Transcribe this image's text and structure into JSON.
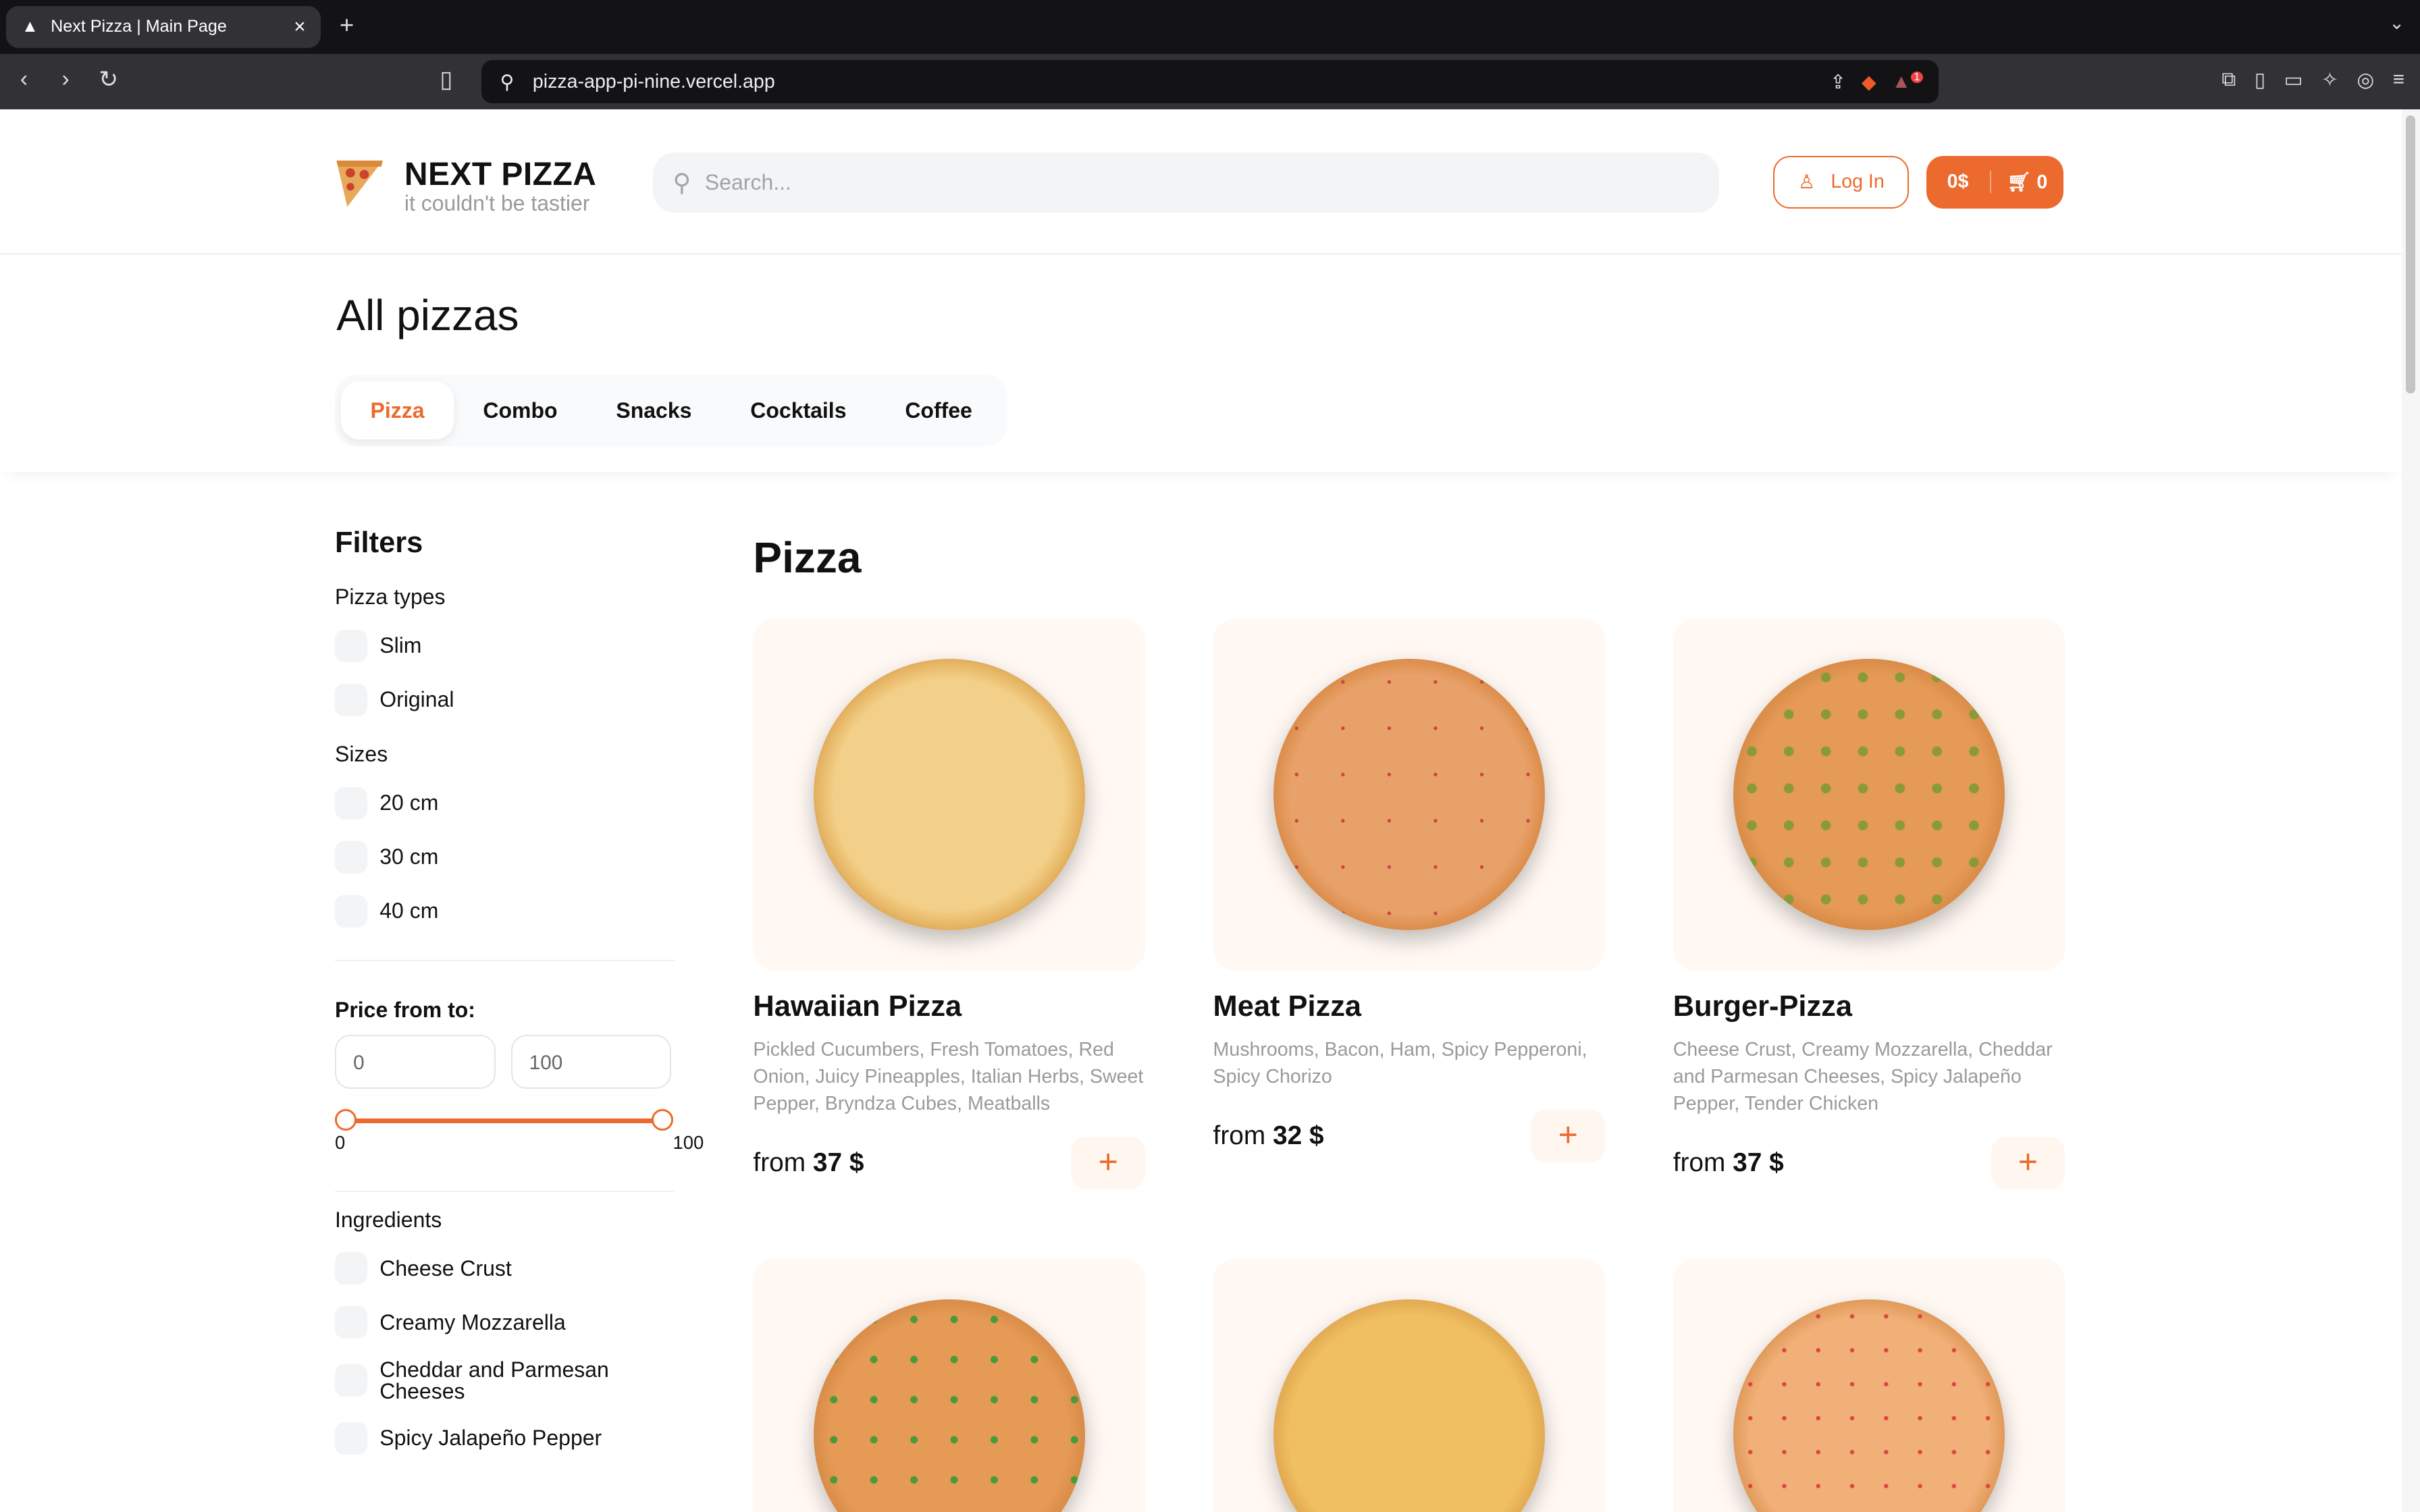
{
  "browser": {
    "tab_title": "Next Pizza | Main Page",
    "url": "pizza-app-pi-nine.vercel.app",
    "notif_count": "1"
  },
  "header": {
    "brand": "NEXT PIZZA",
    "tagline": "it couldn't be tastier",
    "search_placeholder": "Search...",
    "login": "Log In",
    "cart_total": "0$",
    "cart_count": "0"
  },
  "page_title": "All pizzas",
  "categories": [
    "Pizza",
    "Combo",
    "Snacks",
    "Cocktails",
    "Coffee"
  ],
  "filters": {
    "title": "Filters",
    "pizza_types_label": "Pizza types",
    "pizza_types": [
      "Slim",
      "Original"
    ],
    "sizes_label": "Sizes",
    "sizes": [
      "20 cm",
      "30 cm",
      "40 cm"
    ],
    "price_label": "Price from to:",
    "price_from": "0",
    "price_to": "100",
    "slider_min": "0",
    "slider_max": "100",
    "ingredients_label": "Ingredients",
    "ingredients": [
      "Cheese Crust",
      "Creamy Mozzarella",
      "Cheddar and Parmesan Cheeses",
      "Spicy Jalapeño Pepper"
    ]
  },
  "section_title": "Pizza",
  "products": [
    {
      "name": "Hawaiian Pizza",
      "desc": "Pickled Cucumbers, Fresh Tomatoes, Red Onion, Juicy Pineapples, Italian Herbs, Sweet Pepper, Bryndza Cubes, Meatballs",
      "from": "from",
      "price": "37 $"
    },
    {
      "name": "Meat Pizza",
      "desc": "Mushrooms, Bacon, Ham, Spicy Pepperoni, Spicy Chorizo",
      "from": "from",
      "price": "32 $"
    },
    {
      "name": "Burger-Pizza",
      "desc": "Cheese Crust, Creamy Mozzarella, Cheddar and Parmesan Cheeses, Spicy Jalapeño Pepper, Tender Chicken",
      "from": "from",
      "price": "37 $"
    }
  ],
  "colors": {
    "accent": "#EC6A2E"
  }
}
